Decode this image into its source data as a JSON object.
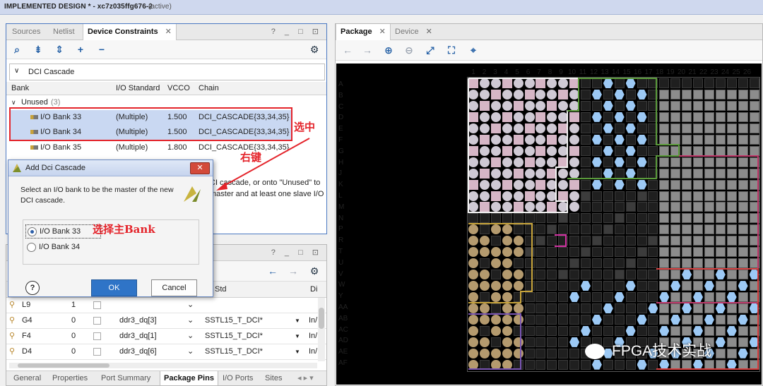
{
  "title": {
    "main": "IMPLEMENTED DESIGN * - xc7z035ffg676-2",
    "status": "(active)"
  },
  "left_panel": {
    "tabs": [
      {
        "label": "Sources"
      },
      {
        "label": "Netlist"
      },
      {
        "label": "Device Constraints"
      }
    ],
    "window_controls": "? _ □ ⊡",
    "dci_group": "DCI Cascade",
    "columns": [
      "Bank",
      "I/O Standard",
      "VCCO",
      "Chain"
    ],
    "unused_label": "Unused",
    "unused_count": "(3)",
    "rows": [
      {
        "bank": "I/O Bank 33",
        "std": "(Multiple)",
        "vcco": "1.500",
        "chain": "DCI_CASCADE{33,34,35}"
      },
      {
        "bank": "I/O Bank 34",
        "std": "(Multiple)",
        "vcco": "1.500",
        "chain": "DCI_CASCADE{33,34,35}"
      },
      {
        "bank": "I/O Bank 35",
        "std": "(Multiple)",
        "vcco": "1.800",
        "chain": "DCI_CASCADE{33,34,35}"
      }
    ],
    "hint_line1": "CI cascade, or onto \"Unused\" to",
    "hint_line2": "master and at least one slave I/O"
  },
  "annotations": {
    "select": "选中",
    "right_click": "右键",
    "choose_master": "选择主Bank"
  },
  "dialog": {
    "title": "Add Dci Cascade",
    "message_line1": "Select an I/O bank to be the master of the new",
    "message_line2": "DCI cascade.",
    "options": [
      {
        "label": "I/O Bank 33",
        "selected": true
      },
      {
        "label": "I/O Bank 34",
        "selected": false
      }
    ],
    "ok": "OK",
    "cancel": "Cancel",
    "help": "?"
  },
  "pins_panel": {
    "controls": "? _ □ ⊡",
    "col_std": "Std",
    "col_dir": "Di",
    "rows": [
      {
        "pin": "L9",
        "val": "1",
        "port": "",
        "std": "",
        "dir": ""
      },
      {
        "pin": "G4",
        "val": "0",
        "port": "ddr3_dq[3]",
        "std": "SSTL15_T_DCI*",
        "dir": "In/"
      },
      {
        "pin": "F4",
        "val": "0",
        "port": "ddr3_dq[1]",
        "std": "SSTL15_T_DCI*",
        "dir": "In/"
      },
      {
        "pin": "D4",
        "val": "0",
        "port": "ddr3_dq[6]",
        "std": "SSTL15_T_DCI*",
        "dir": "In/"
      }
    ],
    "bottom_tabs": [
      "General",
      "Properties",
      "Port Summary",
      "Package Pins",
      "I/O Ports",
      "Sites"
    ]
  },
  "right_panel": {
    "tabs": [
      {
        "label": "Package"
      },
      {
        "label": "Device"
      }
    ],
    "col_numbers": [
      "1",
      "2",
      "3",
      "4",
      "5",
      "6",
      "7",
      "8",
      "9",
      "10",
      "11",
      "12",
      "13",
      "14",
      "15",
      "16",
      "17",
      "18",
      "19",
      "20",
      "21",
      "22",
      "23",
      "24",
      "25",
      "26"
    ],
    "row_letters": [
      "A",
      "B",
      "C",
      "D",
      "E",
      "F",
      "G",
      "H",
      "J",
      "K",
      "L",
      "M",
      "N",
      "P",
      "R",
      "T",
      "U",
      "V",
      "W",
      "Y",
      "AA",
      "AB",
      "AC",
      "AD",
      "AE",
      "AF"
    ],
    "watermark": "FPGA技术实战"
  },
  "colors": {
    "accent": "#2f74c7",
    "annotation": "#e4242b",
    "selection": "#c9d8f2"
  }
}
